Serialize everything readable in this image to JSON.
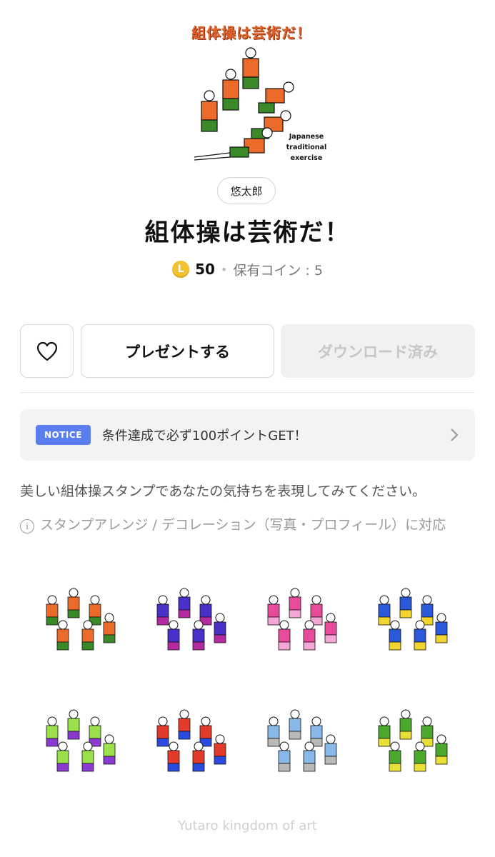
{
  "product": {
    "thumbnail_title": "組体操は芸術だ！",
    "thumbnail_caption": "Japanese\ntraditional\nexercise",
    "author": "悠太郎",
    "title": "組体操は芸術だ！",
    "coin_icon": "L",
    "price": "50",
    "owned_coins": "保有コイン : 5"
  },
  "actions": {
    "like_icon": "heart-icon",
    "gift_label": "プレゼントする",
    "download_label": "ダウンロード済み"
  },
  "notice": {
    "badge": "NOTICE",
    "text": "条件達成で必ず100ポイントGET！"
  },
  "description": "美しい組体操スタンプであなたの気持ちを表現してみてください。",
  "info": "スタンプアレンジ / デコレーション（写真・プロフィール）に対応",
  "stickers": [
    {
      "colors": [
        "#ec6a2a",
        "#3a8a2a"
      ]
    },
    {
      "colors": [
        "#4a2fc9",
        "#b52aa0"
      ]
    },
    {
      "colors": [
        "#e84b9a",
        "#f5a7d3"
      ]
    },
    {
      "colors": [
        "#2a5ad9",
        "#f3d530"
      ]
    },
    {
      "colors": [
        "#9ae04a",
        "#8a3ad0"
      ]
    },
    {
      "colors": [
        "#e43a2a",
        "#2a4ae0"
      ]
    },
    {
      "colors": [
        "#88b8e8",
        "#b8b8b8"
      ]
    },
    {
      "colors": [
        "#4aa82a",
        "#e8e038"
      ]
    }
  ],
  "footer": "Yutaro kingdom of art",
  "colors": {
    "accent": "#5a7df0",
    "coin": "#f2c230"
  }
}
